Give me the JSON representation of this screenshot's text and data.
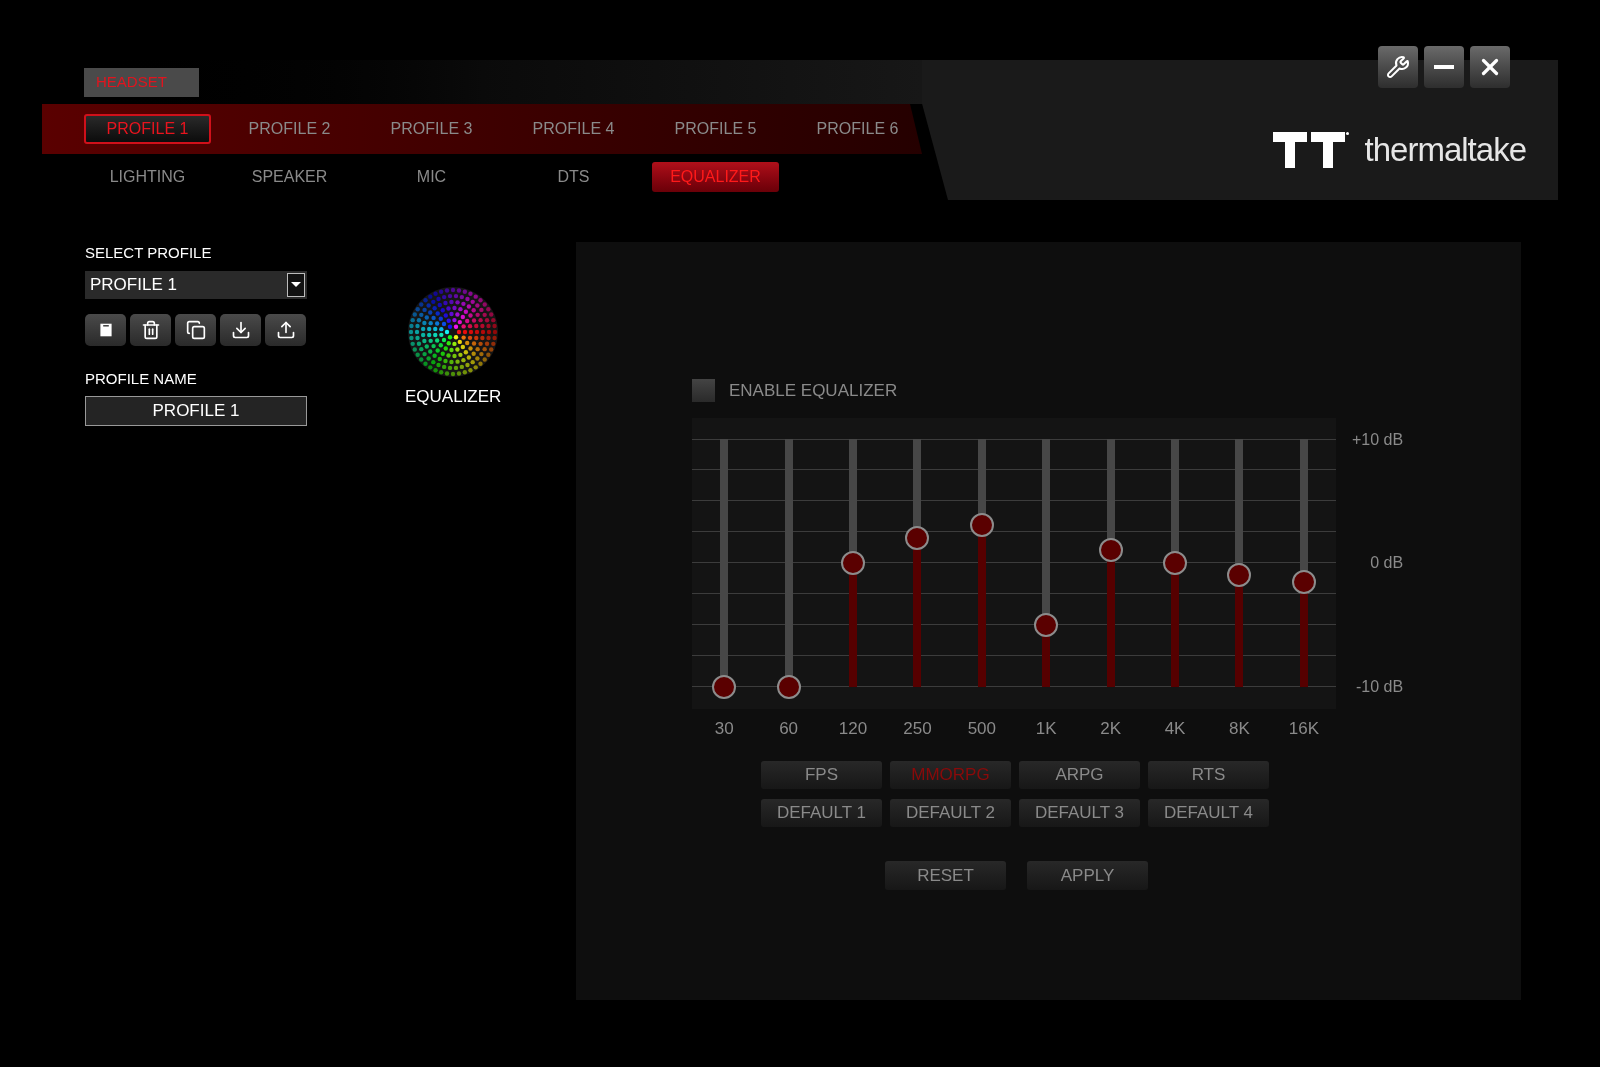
{
  "device_tab": "HEADSET",
  "profile_tabs": [
    {
      "label": "PROFILE 1",
      "selected": true
    },
    {
      "label": "PROFILE 2",
      "selected": false
    },
    {
      "label": "PROFILE 3",
      "selected": false
    },
    {
      "label": "PROFILE 4",
      "selected": false
    },
    {
      "label": "PROFILE 5",
      "selected": false
    },
    {
      "label": "PROFILE 6",
      "selected": false
    }
  ],
  "section_tabs": [
    {
      "label": "LIGHTING",
      "selected": false
    },
    {
      "label": "SPEAKER",
      "selected": false
    },
    {
      "label": "MIC",
      "selected": false
    },
    {
      "label": "DTS",
      "selected": false
    },
    {
      "label": "EQUALIZER",
      "selected": true
    }
  ],
  "logo_text": "thermaltake",
  "select_profile": {
    "label": "SELECT PROFILE",
    "value": "PROFILE 1"
  },
  "profile_actions": [
    {
      "kind": "save"
    },
    {
      "kind": "delete"
    },
    {
      "kind": "copy"
    },
    {
      "kind": "import"
    },
    {
      "kind": "export"
    }
  ],
  "profile_name": {
    "label": "PROFILE NAME",
    "value": "PROFILE 1"
  },
  "mode_label": "EQUALIZER",
  "equalizer": {
    "enable": {
      "label": "ENABLE EQUALIZER",
      "checked": false
    },
    "scale_labels": [
      "+10 dB",
      "0 dB",
      "-10 dB"
    ],
    "bands": [
      {
        "label": "30",
        "level": 0
      },
      {
        "label": "60",
        "level": 0
      },
      {
        "label": "120",
        "level": 0.5
      },
      {
        "label": "250",
        "level": 0.6
      },
      {
        "label": "500",
        "level": 0.65
      },
      {
        "label": "1K",
        "level": 0.25
      },
      {
        "label": "2K",
        "level": 0.55
      },
      {
        "label": "4K",
        "level": 0.5
      },
      {
        "label": "8K",
        "level": 0.45
      },
      {
        "label": "16K",
        "level": 0.42
      }
    ],
    "presets": [
      {
        "label": "FPS",
        "selected": false
      },
      {
        "label": "MMORPG",
        "selected": true
      },
      {
        "label": "ARPG",
        "selected": false
      },
      {
        "label": "RTS",
        "selected": false
      },
      {
        "label": "DEFAULT 1",
        "selected": false
      },
      {
        "label": "DEFAULT 2",
        "selected": false
      },
      {
        "label": "DEFAULT 3",
        "selected": false
      },
      {
        "label": "DEFAULT 4",
        "selected": false
      }
    ],
    "actions": [
      "RESET",
      "APPLY"
    ]
  }
}
